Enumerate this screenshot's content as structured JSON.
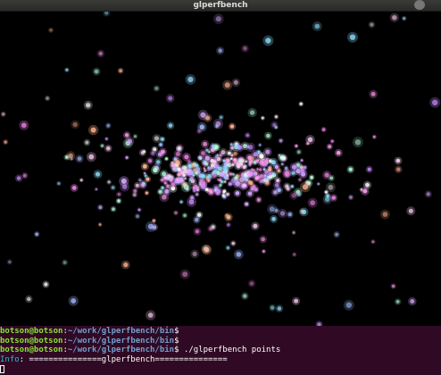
{
  "window": {
    "title": "glperfbench",
    "close_glyph": "●"
  },
  "scene": {
    "background": "#000000",
    "description": "glperfbench points render"
  },
  "terminal": {
    "background": "#300a24",
    "user_color": "#8ae234",
    "path_color": "#729fcf",
    "lines": [
      {
        "user": "botson@botson",
        "sep": ":",
        "path": "~/work/glperfbench/bin",
        "suffix": "$",
        "cmd": ""
      },
      {
        "user": "botson@botson",
        "sep": ":",
        "path": "~/work/glperfbench/bin",
        "suffix": "$",
        "cmd": ""
      },
      {
        "user": "botson@botson",
        "sep": ":",
        "path": "~/work/glperfbench/bin",
        "suffix": "$",
        "cmd": " ./glperfbench points"
      }
    ],
    "info_label": "Info",
    "info_text": ": ===============glperfbench===============",
    "cursor_glyph": "close-icon"
  }
}
